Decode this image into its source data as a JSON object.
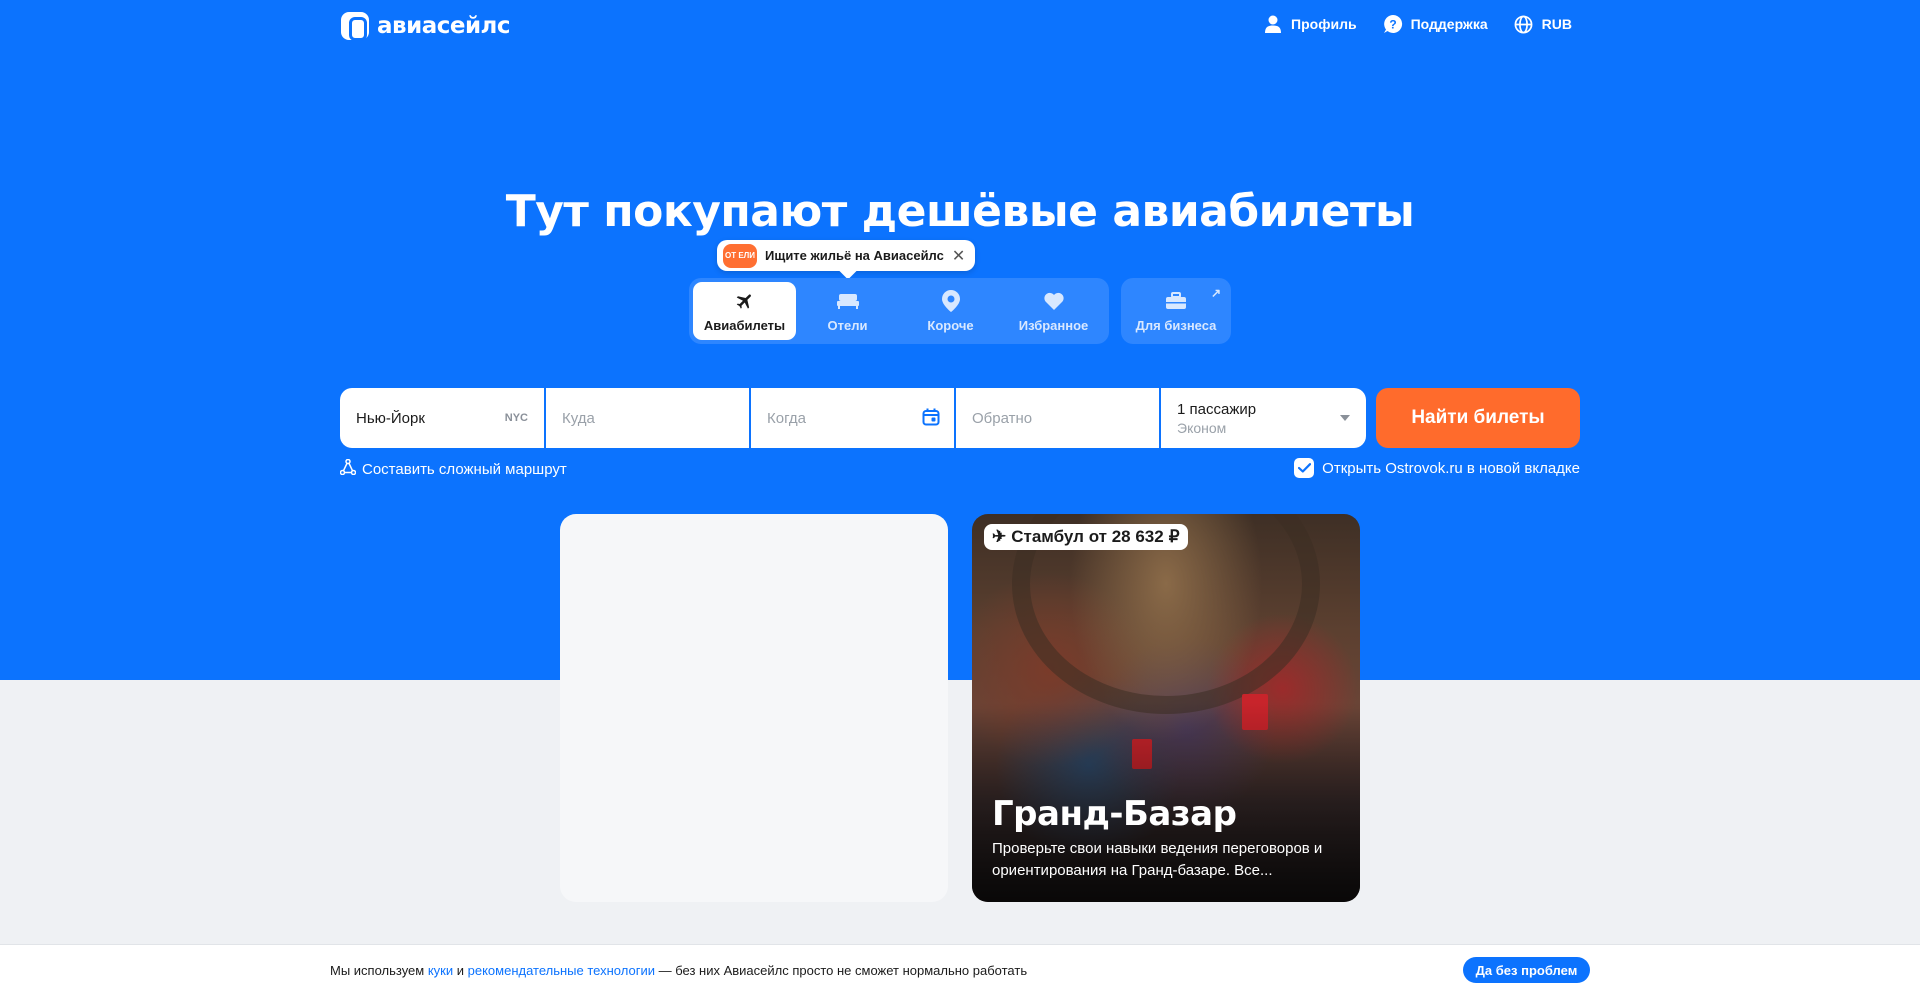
{
  "header": {
    "logo_text": "авиасейлс",
    "nav": [
      {
        "label": "Профиль",
        "icon": "user-icon"
      },
      {
        "label": "Поддержка",
        "icon": "help-icon"
      },
      {
        "label": "RUB",
        "icon": "globe-icon"
      }
    ]
  },
  "hero": {
    "title": "Тут покупают дешёвые авиабилеты"
  },
  "tooltip": {
    "badge": "ОТ ЕЛИ",
    "text": "Ищите жильё на Авиасейлс"
  },
  "tabs": [
    {
      "label": "Авиабилеты",
      "icon": "plane-icon",
      "active": true
    },
    {
      "label": "Отели",
      "icon": "bed-icon",
      "active": false
    },
    {
      "label": "Короче",
      "icon": "pin-icon",
      "active": false
    },
    {
      "label": "Избранное",
      "icon": "heart-icon",
      "active": false
    }
  ],
  "business_tab": {
    "label": "Для бизнеса",
    "icon": "briefcase-icon"
  },
  "search": {
    "origin_value": "Нью-Йорк",
    "origin_iata": "NYC",
    "destination_placeholder": "Куда",
    "depart_placeholder": "Когда",
    "return_placeholder": "Обратно",
    "passengers": "1 пассажир",
    "cabin_class": "Эконом",
    "button_label": "Найти билеты"
  },
  "route_link": "Составить сложный маршрут",
  "open_tab_option": {
    "label": "Открыть Ostrovok.ru в новой вкладке",
    "checked": true
  },
  "promo_card": {
    "price_label": "Стамбул от 28 632",
    "title": "Гранд-Базар",
    "description": "Проверьте свои навыки ведения переговоров и ориентирования на Гранд-базаре. Все..."
  },
  "cookie_bar": {
    "text_before": "Мы используем ",
    "link_cookies": "куки",
    "text_and": " и ",
    "link_tech": "рекомендательные технологии",
    "text_after": " — без них Авиасейлс просто не сможет нормально работать",
    "button_label": "Да без проблем"
  },
  "colors": {
    "brand_blue": "#0c73fe",
    "accent_orange": "#ff6b2c",
    "page_bg": "#eff1f4"
  }
}
